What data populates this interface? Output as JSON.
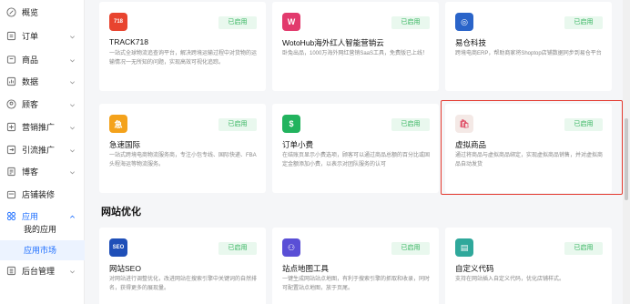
{
  "sidebar": {
    "items": [
      {
        "label": "概览",
        "icon": "overview-icon",
        "chevron": false
      },
      {
        "label": "订单",
        "icon": "order-icon",
        "chevron": true
      },
      {
        "label": "商品",
        "icon": "product-icon",
        "chevron": true
      },
      {
        "label": "数据",
        "icon": "data-icon",
        "chevron": true
      },
      {
        "label": "顾客",
        "icon": "customer-icon",
        "chevron": true
      },
      {
        "label": "营销推广",
        "icon": "marketing-icon",
        "chevron": true
      },
      {
        "label": "引流推广",
        "icon": "traffic-icon",
        "chevron": true
      },
      {
        "label": "博客",
        "icon": "blog-icon",
        "chevron": true
      },
      {
        "label": "店铺装修",
        "icon": "store-design-icon",
        "chevron": false
      },
      {
        "label": "应用",
        "icon": "apps-icon",
        "chevron": true,
        "expanded": true
      }
    ],
    "sub_items": [
      {
        "label": "我的应用"
      },
      {
        "label": "应用市场",
        "selected": true
      }
    ],
    "bottom_item": {
      "label": "后台管理",
      "icon": "admin-icon"
    }
  },
  "status_label": "已启用",
  "cards_top": [
    {
      "name": "TRACK718",
      "desc": "一站式全球物流追查询平台，解决跨境运输过程中对货物的运输情况一无所知的问题，实现高效可视化追踪。",
      "logo": "track718-logo",
      "color": "#e8442f",
      "logo_text": "718"
    },
    {
      "name": "WotoHub海外红人智能营销云",
      "desc": "卧兔出品，1000万海外网红营销SaaS工具，免费版已上线！",
      "logo": "wotohub-logo",
      "color": "#e23a6d",
      "logo_text": "W"
    },
    {
      "name": "易仓科技",
      "desc": "跨境电商ERP，帮助商家将Shoptop店铺数据同步到易仓平台",
      "logo": "eccang-logo",
      "color": "#2a64c9",
      "logo_text": "◎"
    }
  ],
  "cards_mid": [
    {
      "name": "急速国际",
      "desc": "一站式跨境电商物流服务商，专注小包专线、国际快递、FBA头程海运等物流服务。",
      "logo": "jisu-logo",
      "color": "#f4a21b",
      "logo_text": "急"
    },
    {
      "name": "订单小费",
      "desc": "在结账页显示小费选项，顾客可以通过商品总额的百分比或固定金额添加小费，以表示对团队服务的认可",
      "logo": "tip-logo",
      "color": "#22b35e",
      "logo_text": "$"
    },
    {
      "name": "虚拟商品",
      "desc": "通过将商品与虚拟商品绑定，实现虚拟商品销售，并对虚拟商品自动发货",
      "logo": "virtual-goods-logo",
      "color": "#f4e9e6",
      "logo_text": "🛍"
    }
  ],
  "section": {
    "title": "网站优化"
  },
  "cards_bottom": [
    {
      "name": "网站SEO",
      "desc": "对网站进行调整优化，改进网站在搜索引擎中关键词的自然排名，获得更多的展现量。",
      "logo": "seo-logo",
      "color": "#1f4fb8",
      "logo_text": "SEO"
    },
    {
      "name": "站点地图工具",
      "desc": "一键生成网站站点地图，有利于搜索引擎的抓取和收录，同时可配置站点地图，放于页尾。",
      "logo": "sitemap-logo",
      "color": "#5a4fd6",
      "logo_text": "⚇"
    },
    {
      "name": "自定义代码",
      "desc": "支持在网站插入自定义代码，优化店铺样式。",
      "logo": "custom-code-logo",
      "color": "#2fa89b",
      "logo_text": "▤"
    }
  ]
}
